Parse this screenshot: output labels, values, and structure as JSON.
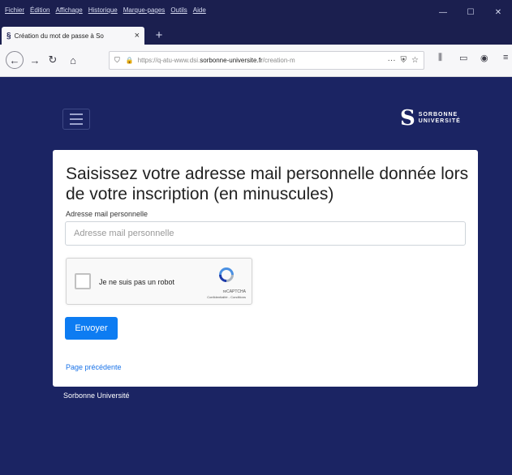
{
  "browser": {
    "menu": [
      "Fichier",
      "Édition",
      "Affichage",
      "Historique",
      "Marque-pages",
      "Outils",
      "Aide"
    ],
    "window_controls": [
      "minimize-icon",
      "maximize-icon",
      "close-icon"
    ],
    "tab": {
      "title": "Création du mot de passe à So",
      "favicon": "§",
      "close": "×"
    },
    "new_tab": "+",
    "url": {
      "prefix": "https://q-atu-www.dsi.",
      "domain": "sorbonne-universite.fr",
      "suffix": "/creation-m",
      "more": "···"
    }
  },
  "header": {
    "brand_mark": "S",
    "brand_line1": "SORBONNE",
    "brand_line2": "UNIVERSITÉ"
  },
  "form": {
    "title": "Saisissez votre adresse mail personnelle donnée lors de votre inscription (en minuscules)",
    "email_label": "Adresse mail personnelle",
    "email_placeholder": "Adresse mail personnelle",
    "email_value": "",
    "captcha_label": "Je ne suis pas un robot",
    "captcha_brand": "reCAPTCHA",
    "captcha_terms": "Confidentialité - Conditions",
    "submit_label": "Envoyer",
    "prev_link": "Page précédente"
  },
  "footer": {
    "text": "Sorbonne Université"
  },
  "colors": {
    "chrome": "#1b1f4f",
    "page_bg": "#1b2463",
    "primary_button": "#0d7cf2",
    "link": "#1a73e8"
  }
}
